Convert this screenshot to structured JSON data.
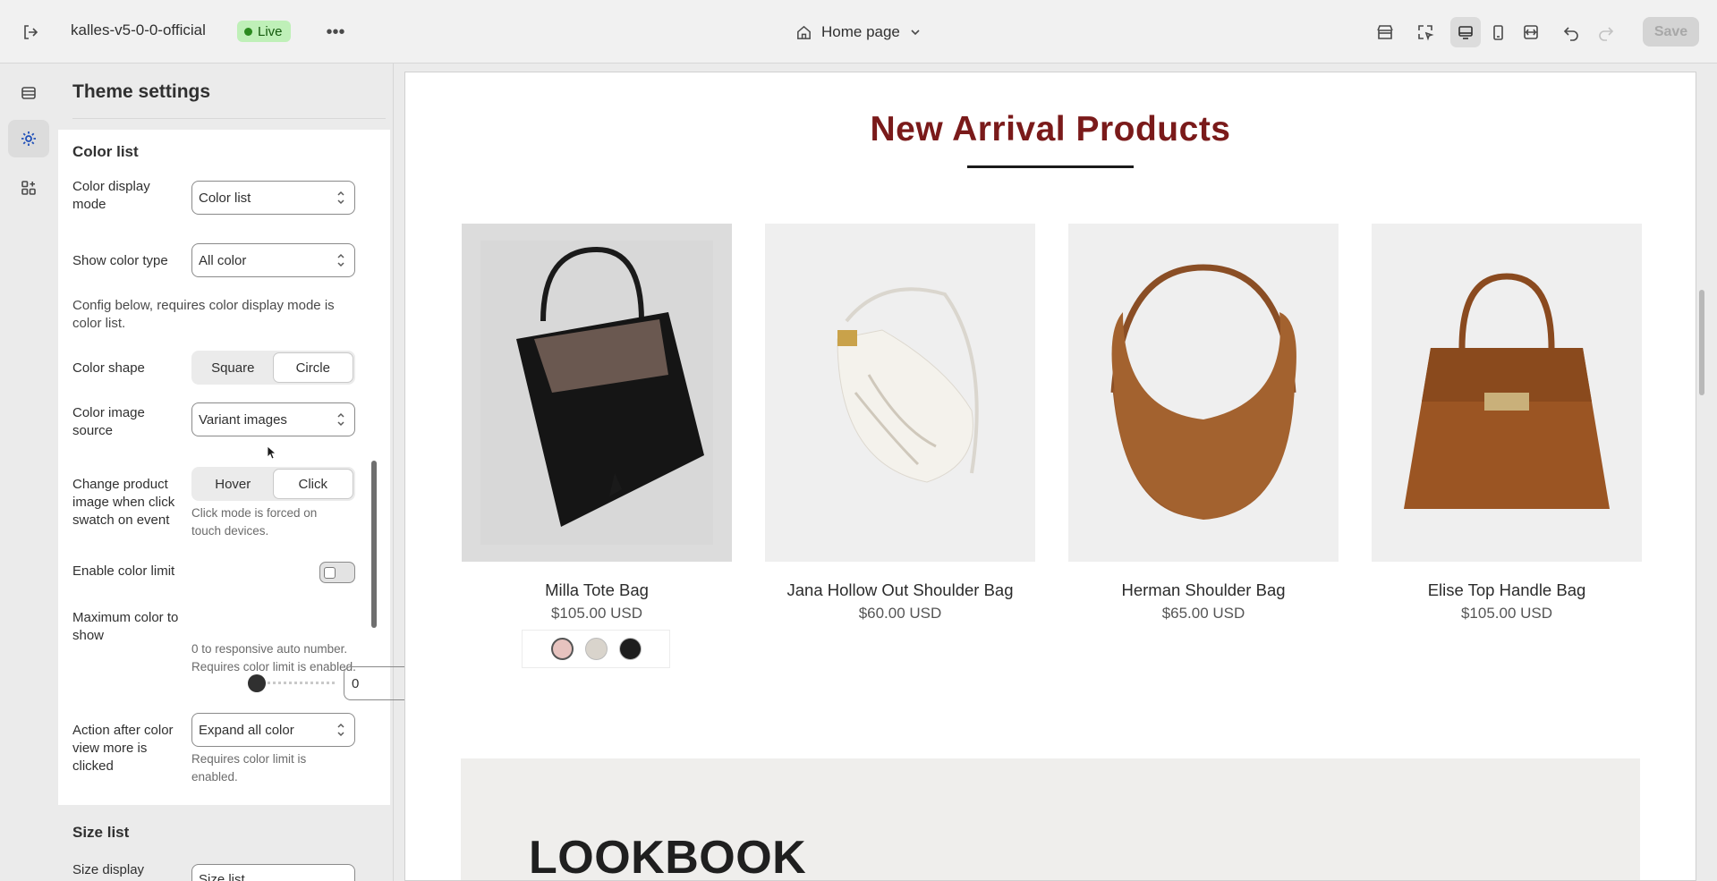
{
  "topbar": {
    "store_name": "kalles-v5-0-0-official",
    "status": "Live",
    "page_label": "Home page",
    "save_label": "Save"
  },
  "panel": {
    "title": "Theme settings",
    "color_list": {
      "heading": "Color list",
      "display_mode": {
        "label": "Color display mode",
        "value": "Color list"
      },
      "show_color_type": {
        "label": "Show color type",
        "value": "All color"
      },
      "config_note": "Config below, requires color display mode is color list.",
      "color_shape": {
        "label": "Color shape",
        "options": [
          "Square",
          "Circle"
        ],
        "selected": "Circle"
      },
      "image_source": {
        "label": "Color image source",
        "value": "Variant images"
      },
      "change_image": {
        "label": "Change product image when click swatch on event",
        "options": [
          "Hover",
          "Click"
        ],
        "selected": "Click",
        "help": "Click mode is forced on touch devices."
      },
      "enable_limit": {
        "label": "Enable color limit",
        "enabled": false
      },
      "max_color": {
        "label": "Maximum color to show",
        "value": "0",
        "slider_fraction": 0,
        "help": "0 to responsive auto number. Requires color limit is enabled."
      },
      "action_after": {
        "label": "Action after color view more is clicked",
        "value": "Expand all color",
        "help": "Requires color limit is enabled."
      }
    },
    "size_list": {
      "heading": "Size list",
      "display_label": "Size display",
      "display_value": "Size list"
    }
  },
  "preview": {
    "section_title": "New Arrival Products",
    "products": [
      {
        "name": "Milla Tote Bag",
        "price": "$105.00 USD"
      },
      {
        "name": "Jana Hollow Out Shoulder Bag",
        "price": "$60.00 USD"
      },
      {
        "name": "Herman Shoulder Bag",
        "price": "$65.00 USD"
      },
      {
        "name": "Elise Top Handle Bag",
        "price": "$105.00 USD"
      }
    ],
    "swatch_colors": [
      "#e7c3bf",
      "#d9d4cc",
      "#1e1e1e"
    ],
    "lookbook_title": "LOOKBOOK"
  },
  "colors": {
    "accent_title": "#7a1a1a",
    "live_badge_bg": "#bff0b8"
  }
}
